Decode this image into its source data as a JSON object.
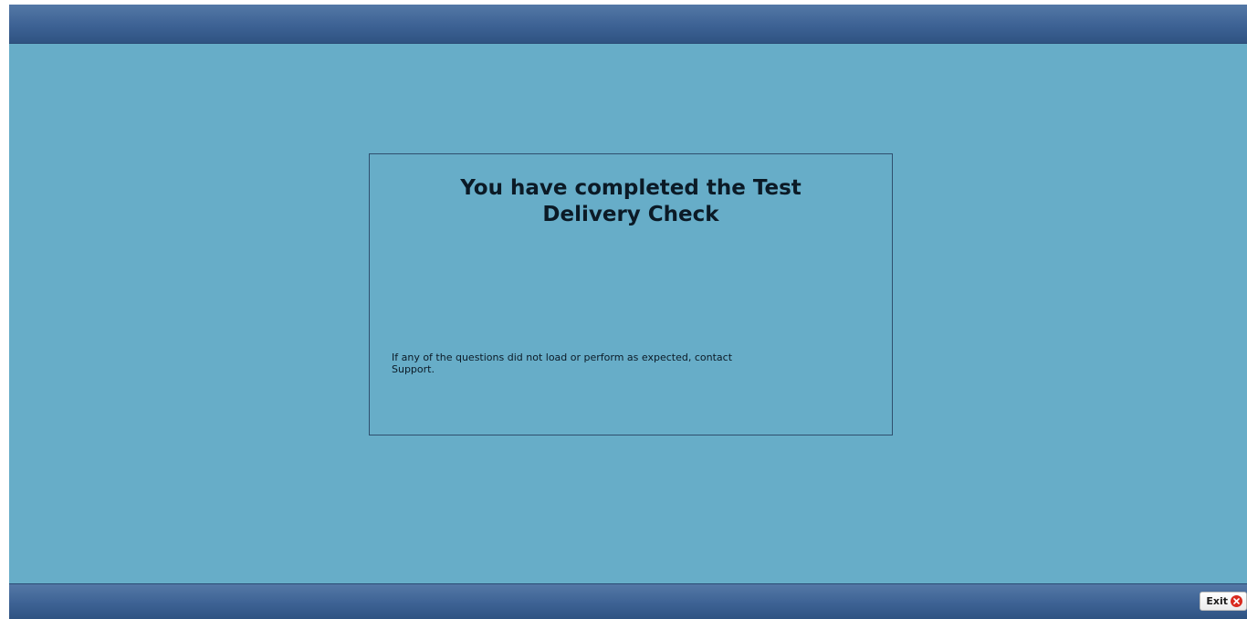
{
  "dialog": {
    "title_line1": "You have completed the Test",
    "title_line2": "Delivery Check",
    "message_line1": "If any of the questions did not load or perform as expected, contact",
    "message_line2": "Support."
  },
  "footer": {
    "exit_label": "Exit",
    "exit_icon": "close-circle-icon"
  },
  "colors": {
    "background": "#67adc8",
    "bar": "#3d6294",
    "exit_icon": "#d92a1e"
  }
}
